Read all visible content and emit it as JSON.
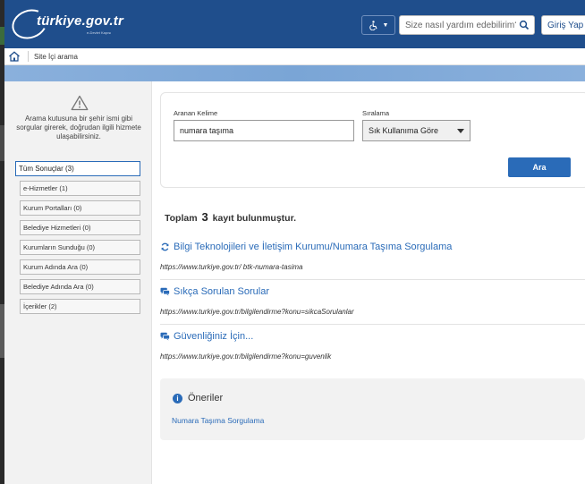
{
  "header": {
    "logo_text": "türkiye.gov.tr",
    "logo_subtext": "e-Devlet Kapısı",
    "search_placeholder": "Size nasıl yardım edebilirim?",
    "login_label": "Giriş Yap",
    "access_icon": "wheelchair-icon"
  },
  "breadcrumb": {
    "current": "Site İçi arama"
  },
  "left": {
    "hint": "Arama kutusuna bir şehir ismi gibi sorgular girerek, doğrudan ilgili hizmete ulaşabilirsiniz.",
    "filters": [
      "Tüm Sonuçlar (3)",
      "e-Hizmetler (1)",
      "Kurum Portalları (0)",
      "Belediye Hizmetleri (0)",
      "Kurumların Sunduğu (0)",
      "Kurum Adında Ara (0)",
      "Belediye Adında Ara (0)",
      "İçerikler (2)"
    ]
  },
  "search_form": {
    "keyword_label": "Aranan Kelime",
    "keyword_value": "numara taşıma",
    "sort_label": "Sıralama",
    "sort_value": "Sık Kullanıma Göre",
    "submit_label": "Ara"
  },
  "results": {
    "total_prefix": "Toplam",
    "total_count": "3",
    "total_suffix": "kayıt bulunmuştur.",
    "items": [
      {
        "icon": "refresh-icon",
        "title": "Bilgi Teknolojileri ve İletişim Kurumu/Numara Taşıma Sorgulama",
        "url": "https://www.turkiye.gov.tr/ btk-numara-tasima"
      },
      {
        "icon": "chat-icon",
        "title": "Sıkça Sorulan Sorular",
        "url": "https://www.turkiye.gov.tr/bilgilendirme?konu=sikcaSorulanlar"
      },
      {
        "icon": "chat-icon",
        "title": "Güvenliğiniz İçin...",
        "url": "https://www.turkiye.gov.tr/bilgilendirme?konu=guvenlik"
      }
    ]
  },
  "suggestions": {
    "title": "Öneriler",
    "items": [
      "Numara Taşıma Sorgulama"
    ]
  },
  "colors": {
    "header_bg": "#1f4e8c",
    "accent": "#2a6bb8",
    "banner": "#7aa5d6"
  }
}
